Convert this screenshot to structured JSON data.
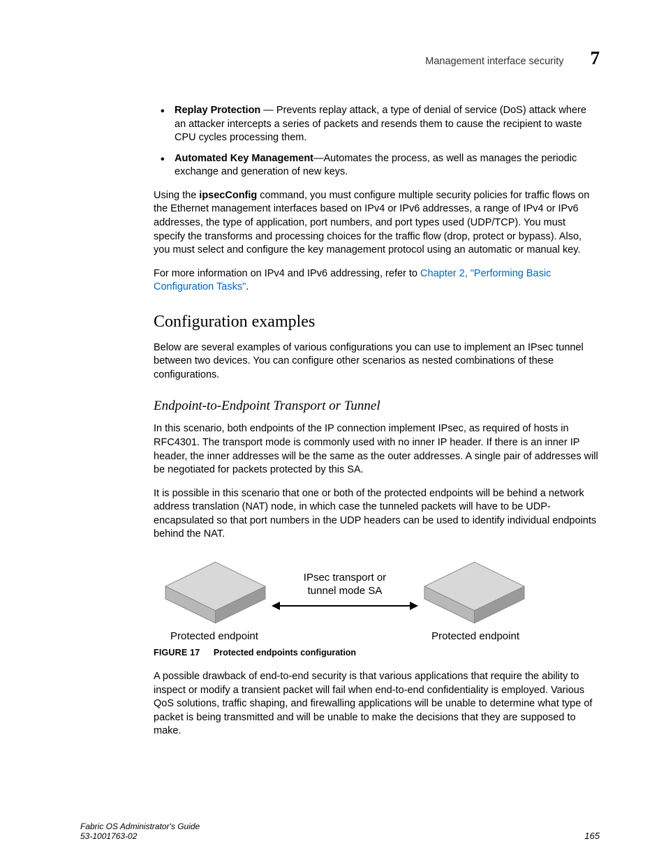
{
  "header": {
    "title": "Management interface security",
    "chapter": "7"
  },
  "bullets": [
    {
      "term": "Replay Protection",
      "sep": " — ",
      "rest": "Prevents replay attack, a type of denial of service (DoS) attack where an attacker intercepts a series of packets and resends them to cause the recipient to waste CPU cycles processing them."
    },
    {
      "term": "Automated Key Management",
      "sep": "—",
      "rest": "Automates the process, as well as manages the periodic exchange and generation of new keys."
    }
  ],
  "para1_a": "Using the ",
  "para1_cmd": "ipsecConfig",
  "para1_b": " command, you must configure multiple security policies for traffic flows on the Ethernet management interfaces based on IPv4 or IPv6 addresses, a range of IPv4 or IPv6 addresses, the type of application, port numbers, and port types used (UDP/TCP). You must specify the transforms and processing choices for the traffic flow (drop, protect or bypass). Also, you must select and configure the key management protocol using an automatic or manual key.",
  "para2_a": "For more information on IPv4 and IPv6 addressing, refer to ",
  "para2_link": "Chapter 2, \"Performing Basic Configuration Tasks\"",
  "para2_b": ".",
  "section_heading": "Configuration examples",
  "para3": "Below are several examples of various configurations you can use to implement an IPsec tunnel between two devices. You can configure other scenarios as nested combinations of these configurations.",
  "subsection_heading": "Endpoint-to-Endpoint Transport or Tunnel",
  "para4": "In this scenario, both endpoints of the IP connection implement IPsec, as required of hosts in RFC4301. The transport mode is commonly used with no inner IP header. If there is an inner IP header, the inner addresses will be the same as the outer addresses. A single pair of addresses will be negotiated for packets protected by this SA.",
  "para5": "It is possible in this scenario that one or both of the protected endpoints will be behind a network address translation (NAT) node, in which case the tunneled packets will have to be UDP-encapsulated so that port numbers in the UDP headers can be used to identify individual endpoints behind the NAT.",
  "figure": {
    "arrow_line1": "IPsec transport or",
    "arrow_line2": "tunnel mode SA",
    "left_label": "Protected endpoint",
    "right_label": "Protected endpoint",
    "caption_num": "FIGURE 17",
    "caption_text": "Protected endpoints configuration"
  },
  "para6": "A possible drawback of end-to-end security is that various applications that require the ability to inspect or modify a transient packet will fail when end-to-end confidentiality is employed. Various QoS solutions, traffic shaping, and firewalling applications will be unable to determine what type of packet is being transmitted and will be unable to make the decisions that they are supposed to make.",
  "footer": {
    "left1": "Fabric OS Administrator's Guide",
    "left2": "53-1001763-02",
    "right": "165"
  }
}
